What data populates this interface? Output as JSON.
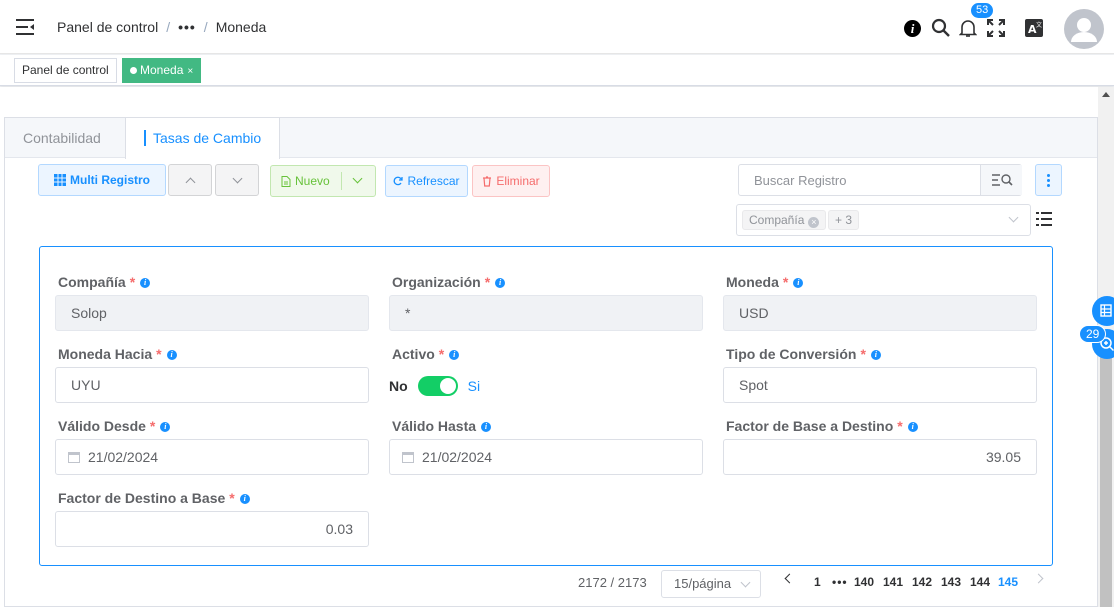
{
  "header": {
    "breadcrumb": [
      "Panel de control",
      "•••",
      "Moneda"
    ],
    "notification_count": "53",
    "icons": [
      "menu-icon",
      "info-icon",
      "search-icon",
      "bell-icon",
      "fullscreen-icon",
      "translate-icon",
      "user-avatar"
    ]
  },
  "tags": [
    {
      "label": "Panel de control",
      "active": false
    },
    {
      "label": "Moneda",
      "active": true,
      "close": "×"
    }
  ],
  "tabs": [
    "Contabilidad",
    "Tasas de Cambio"
  ],
  "toolbar": {
    "multi": "Multi Registro",
    "nuevo": "Nuevo",
    "refrescar": "Refrescar",
    "eliminar": "Eliminar",
    "search_placeholder": "Buscar Registro",
    "filter_tag": "Compañía",
    "filter_more": "+ 3"
  },
  "form": {
    "compania": {
      "label": "Compañía",
      "value": "Solop"
    },
    "organizacion": {
      "label": "Organización",
      "value": "*"
    },
    "moneda": {
      "label": "Moneda",
      "value": "USD"
    },
    "moneda_hacia": {
      "label": "Moneda Hacia",
      "value": "UYU"
    },
    "activo": {
      "label": "Activo",
      "off": "No",
      "on": "Si",
      "checked": true
    },
    "tipo_conversion": {
      "label": "Tipo de Conversión",
      "value": "Spot"
    },
    "valido_desde": {
      "label": "Válido Desde",
      "value": "21/02/2024"
    },
    "valido_hasta": {
      "label": "Válido Hasta",
      "value": "21/02/2024"
    },
    "factor_bd": {
      "label": "Factor de Base a Destino",
      "value": "39.05"
    },
    "factor_db": {
      "label": "Factor de Destino a Base",
      "value": "0.03"
    }
  },
  "pagination": {
    "record": "2172 / 2173",
    "page_size": "15/página",
    "pages": [
      "1",
      "•••",
      "140",
      "141",
      "142",
      "143",
      "144",
      "145"
    ],
    "current": "145"
  },
  "float_badge": "29",
  "colors": {
    "primary": "#1890ff",
    "success": "#42b983",
    "switch": "#13ce66",
    "danger": "#f56c6c"
  }
}
